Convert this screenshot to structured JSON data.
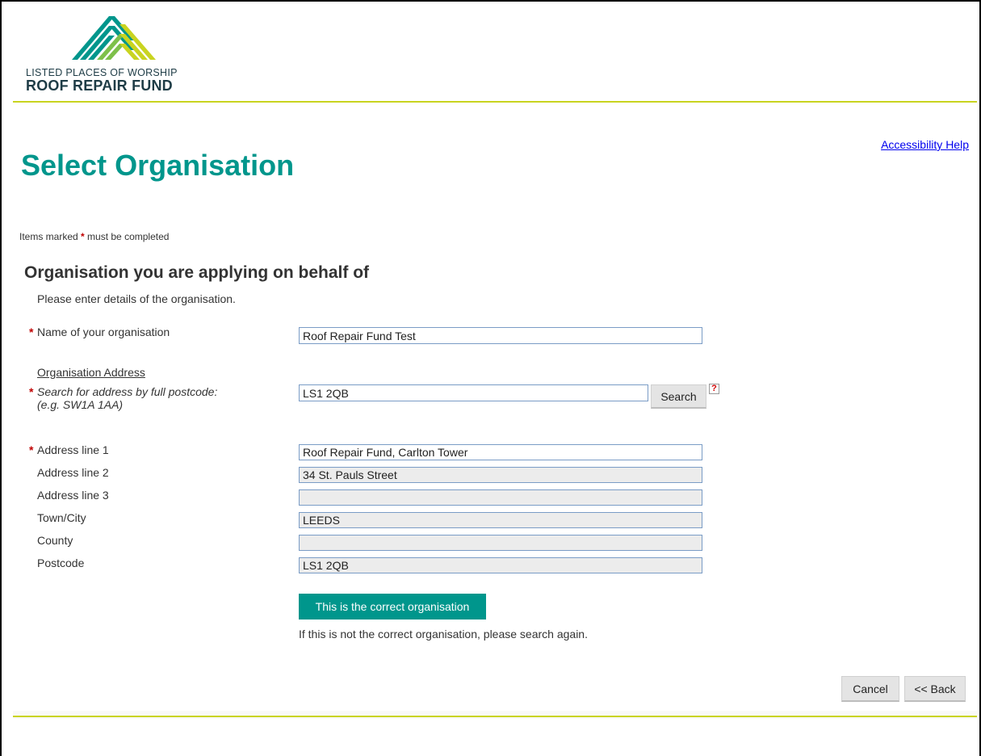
{
  "brand": {
    "line1": "LISTED PLACES OF WORSHIP",
    "line2": "ROOF REPAIR FUND",
    "colors": {
      "teal": "#00968c",
      "green": "#c9d420",
      "navy": "#1e3c46"
    }
  },
  "accessibility_help": "Accessibility Help",
  "page_title": "Select Organisation",
  "required_note": {
    "prefix": "Items marked",
    "star": "*",
    "suffix": "must be completed"
  },
  "section": {
    "title": "Organisation you are applying on behalf of",
    "description": "Please enter details of the organisation."
  },
  "form": {
    "required_star": "*",
    "org_name": {
      "label": "Name of your organisation",
      "value": "Roof Repair Fund Test"
    },
    "address_heading": "Organisation Address",
    "postcode_search": {
      "label": "Search for address by full postcode:",
      "example": "(e.g. SW1A 1AA)",
      "value": "LS1 2QB",
      "button": "Search",
      "help_icon": "?"
    },
    "address_line1": {
      "label": "Address line 1",
      "value": "Roof Repair Fund, Carlton Tower"
    },
    "address_line2": {
      "label": "Address line 2",
      "value": "34 St. Pauls Street"
    },
    "address_line3": {
      "label": "Address line 3",
      "value": ""
    },
    "town": {
      "label": "Town/City",
      "value": "LEEDS"
    },
    "county": {
      "label": "County",
      "value": ""
    },
    "postcode": {
      "label": "Postcode",
      "value": "LS1 2QB"
    }
  },
  "confirm_button": "This is the correct organisation",
  "confirm_note": "If this is not the correct organisation, please search again.",
  "nav": {
    "cancel": "Cancel",
    "back": "<< Back"
  }
}
